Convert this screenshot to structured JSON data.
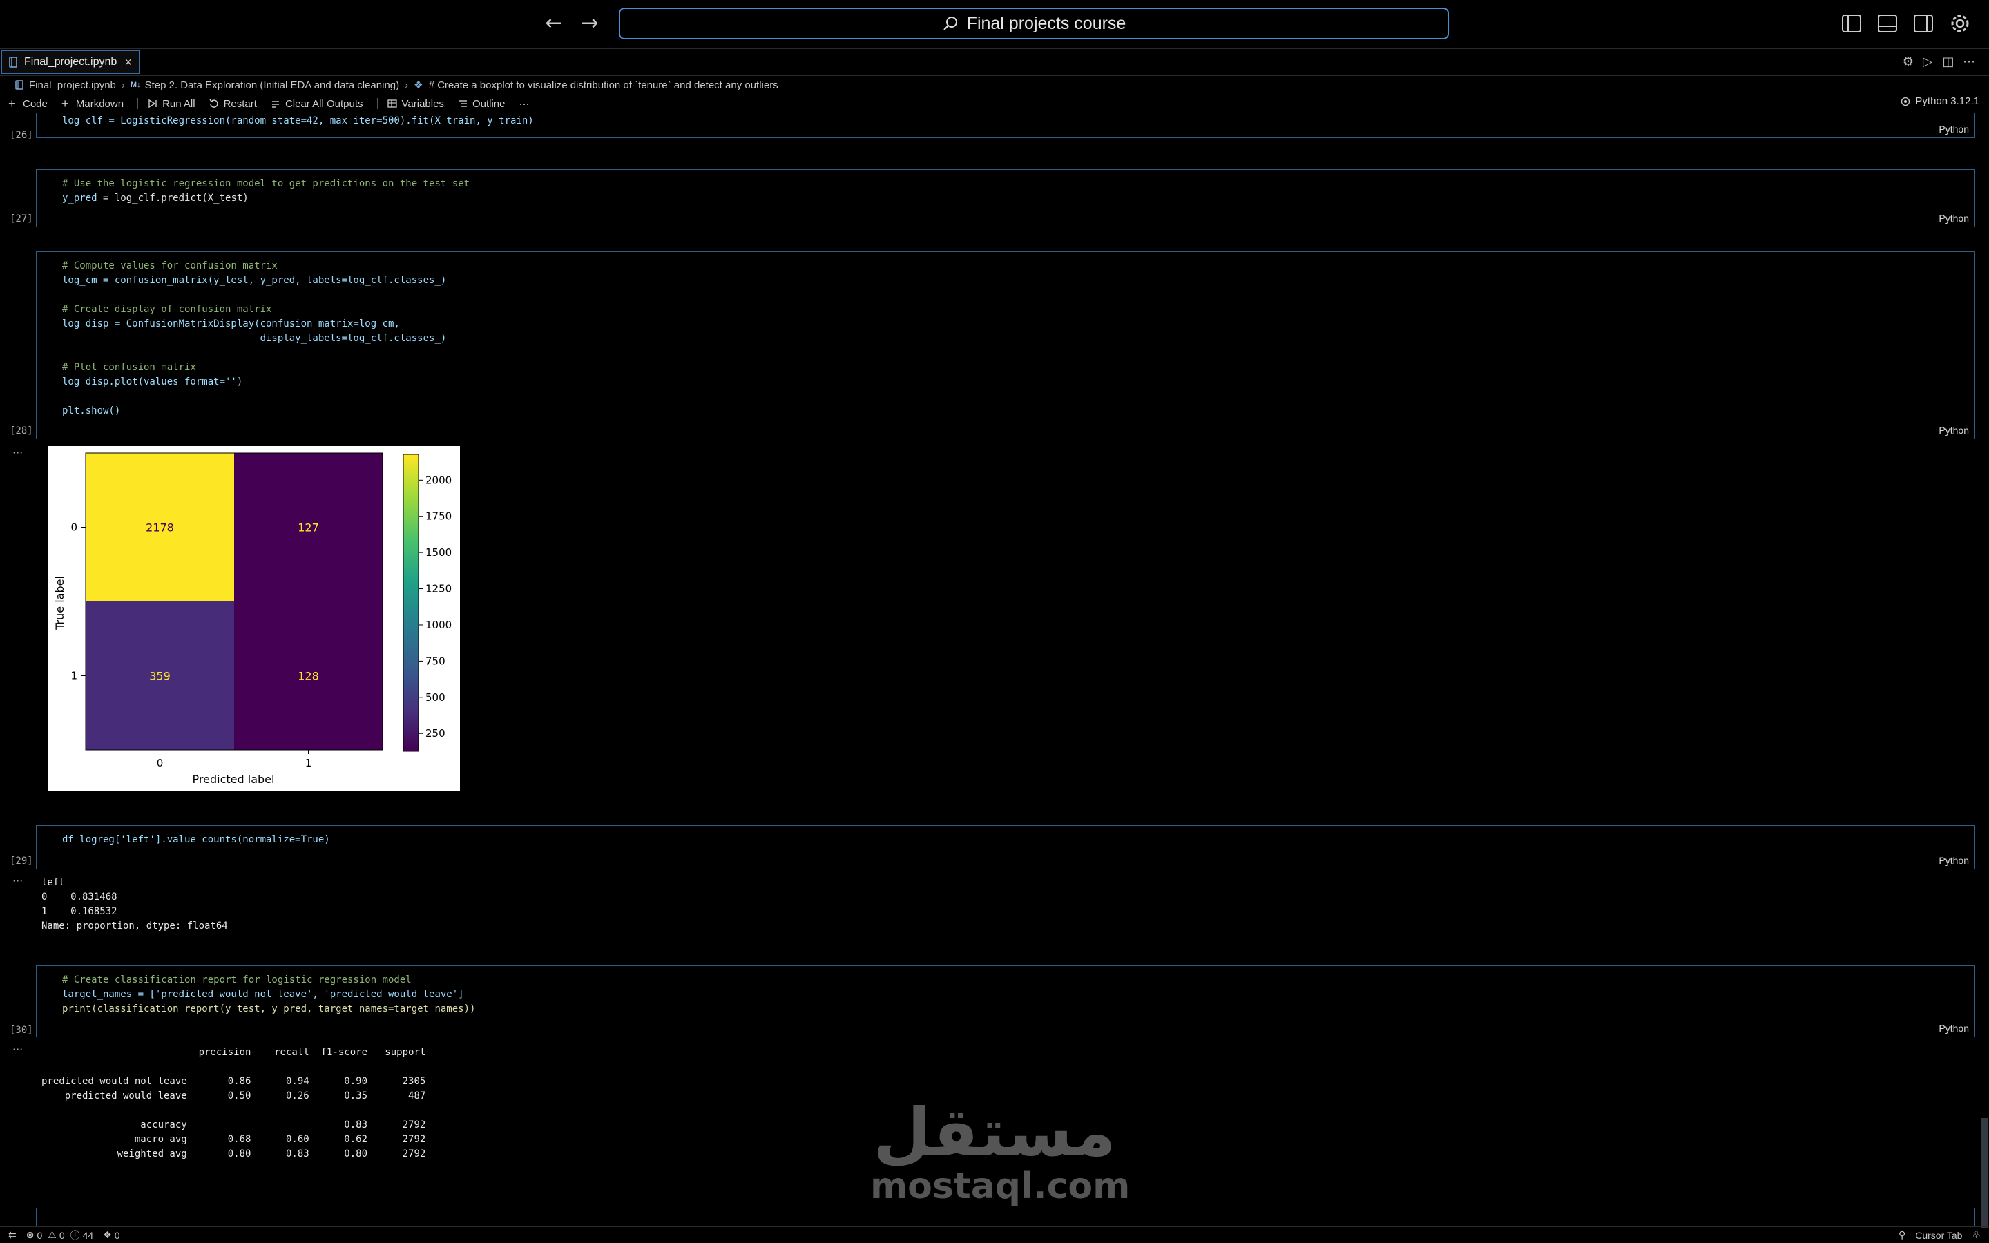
{
  "titlebar": {
    "search_text": "Final projects course"
  },
  "tabs": [
    {
      "label": "Final_project.ipynb",
      "active": true
    }
  ],
  "breadcrumb": {
    "file": "Final_project.ipynb",
    "md_badge": "M↓",
    "section": "Step 2. Data Exploration (Initial EDA and data cleaning)",
    "cell": "# Create a boxplot to visualize distribution of `tenure` and detect any outliers"
  },
  "toolbar": {
    "code": "Code",
    "markdown": "Markdown",
    "run_all": "Run All",
    "restart": "Restart",
    "clear_outputs": "Clear All Outputs",
    "variables": "Variables",
    "outline": "Outline",
    "more": "···",
    "kernel": "Python 3.12.1"
  },
  "cells": {
    "c26": {
      "exec": "[26]",
      "lang": "Python",
      "line": "log_clf = LogisticRegression(random_state=42, max_iter=500).fit(X_train, y_train)"
    },
    "c27": {
      "exec": "[27]",
      "lang": "Python",
      "line1": "# Use the logistic regression model to get predictions on the test set",
      "line2_var": "y_pred",
      "line2_rest": " = log_clf.predict(X_test)"
    },
    "c28": {
      "exec": "[28]",
      "lang": "Python",
      "comment1": "# Compute values for confusion matrix",
      "line2": "log_cm = confusion_matrix(y_test, y_pred, labels=log_clf.classes_)",
      "comment2": "# Create display of confusion matrix",
      "line4": "log_disp = ConfusionMatrixDisplay(confusion_matrix=log_cm,",
      "line5": "                                  display_labels=log_clf.classes_)",
      "comment3": "# Plot confusion matrix",
      "line7": "log_disp.plot(values_format='')",
      "line8": "plt.show()"
    },
    "c29": {
      "exec": "[29]",
      "lang": "Python",
      "line": "df_logreg['left'].value_counts(normalize=True)",
      "output": "left\n0    0.831468\n1    0.168532\nName: proportion, dtype: float64"
    },
    "c30": {
      "exec": "[30]",
      "lang": "Python",
      "comment": "# Create classification report for logistic regression model",
      "line2": "target_names = ['predicted would not leave', 'predicted would leave']",
      "line3": "print(classification_report(y_test, y_pred, target_names=target_names))",
      "output": "                           precision    recall  f1-score   support\n\npredicted would not leave       0.86      0.94      0.90      2305\n    predicted would leave       0.50      0.26      0.35       487\n\n                 accuracy                           0.83      2792\n                macro avg       0.68      0.60      0.62      2792\n             weighted avg       0.80      0.83      0.80      2792"
    }
  },
  "output_ellipsis": "···",
  "chart_data": {
    "type": "heatmap",
    "title": "",
    "xlabel": "Predicted label",
    "ylabel": "True label",
    "x_categories": [
      "0",
      "1"
    ],
    "y_categories": [
      "0",
      "1"
    ],
    "values": [
      [
        2178,
        127
      ],
      [
        359,
        128
      ]
    ],
    "colormap": "viridis",
    "colorbar_ticks": [
      250,
      500,
      750,
      1000,
      1250,
      1500,
      1750,
      2000
    ],
    "colorbar_range": [
      127,
      2178
    ],
    "cell_colors": [
      [
        "#fde725",
        "#440154"
      ],
      [
        "#472c7a",
        "#440154"
      ]
    ],
    "text_colors": [
      [
        "#440154",
        "#fde725"
      ],
      [
        "#fde725",
        "#fde725"
      ]
    ]
  },
  "statusbar": {
    "branch_icon": "git-branch-icon",
    "errors": "0",
    "warnings": "0",
    "info": "44",
    "ports": "0",
    "cursor_tab": "Cursor Tab"
  },
  "watermark": {
    "arabic": "مستقل",
    "latin": "mostaql.com"
  },
  "colors": {
    "accent": "#4a90d9",
    "cell_border": "#2d5e8a",
    "comment": "#8fb573"
  }
}
